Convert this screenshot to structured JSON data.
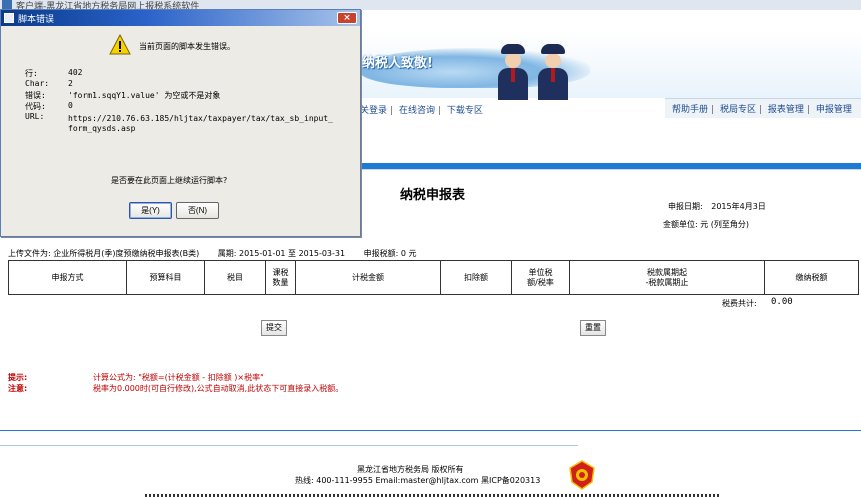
{
  "app": {
    "title": "客户端-黑龙江省地方税务局网上报税系统软件"
  },
  "banner": {
    "slogan": "纳税人致敬!"
  },
  "nav": {
    "left": [
      "关登录",
      "在线咨询",
      "下载专区"
    ],
    "right": [
      "帮助手册",
      "税局专区",
      "报表管理",
      "申报管理"
    ]
  },
  "report": {
    "title": "纳税申报表",
    "date_label": "申报日期:",
    "date_value": "2015年4月3日",
    "unit_label": "金额单位: 元 (列至角分)",
    "upload_label": "上传文件为: 企业所得税月(季)度预缴纳税申报表(B类)",
    "period_label": "属期: 2015-01-01 至 2015-03-31",
    "amount_label": "申报税额: 0 元",
    "columns": [
      "申报方式",
      "预算科目",
      "税目",
      "课税\n数量",
      "计税金额",
      "扣除额",
      "单位税\n额/税率",
      "税款属期起\n-税款属期止",
      "缴纳税额"
    ],
    "total_label": "税费共计:",
    "total_value": "0.00",
    "submit_label": "提交",
    "reset_label": "重置",
    "hint_label": "提示:",
    "hint_text": "计算公式为: \"税额=(计税金额 - 扣除额 )×税率\"",
    "note_label": "注意:",
    "note_text": "税率为0.000时(可自行修改),公式自动取消,此状态下可直接录入税额。"
  },
  "footer": {
    "line1": "黑龙江省地方税务局 版权所有",
    "line2": "热线: 400-111-9955 Email:master@hljtax.com 黑ICP备020313"
  },
  "dialog": {
    "title": "脚本错误",
    "close": "×",
    "message": "当前页面的脚本发生错误。",
    "fields": [
      {
        "key": "行:",
        "value": "402"
      },
      {
        "key": "Char:",
        "value": "2"
      },
      {
        "key": "错误:",
        "value": "'form1.sqqY1.value' 为空或不是对象"
      },
      {
        "key": "代码:",
        "value": "0"
      },
      {
        "key": "URL:",
        "value": "https://210.76.63.185/hljtax/taxpayer/tax/tax_sb_input_"
      },
      {
        "key": "",
        "value": "form_qysds.asp"
      }
    ],
    "question": "是否要在此页面上继续运行脚本?",
    "yes_label": "是(Y)",
    "no_label": "否(N)"
  },
  "colors": {
    "accent": "#1f7ad4",
    "hint": "#c00000",
    "dialog_title": "#0a3a8a"
  }
}
